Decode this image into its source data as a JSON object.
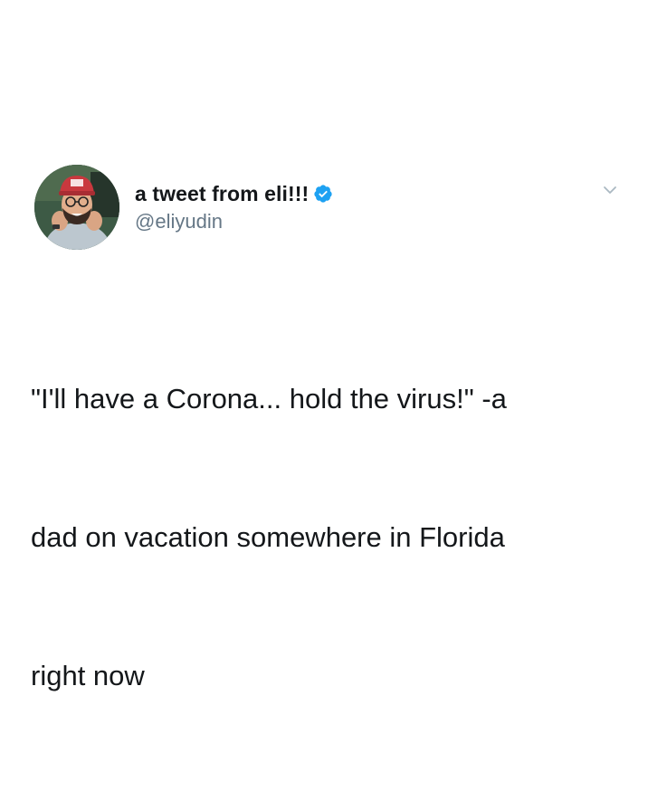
{
  "tweet": {
    "display_name": "a tweet from eli!!!",
    "handle": "@eliyudin",
    "text_lines": [
      "\"I'll have a Corona... hold the virus!\" -a",
      "dad on vacation somewhere in Florida",
      "right now"
    ]
  },
  "icons": {
    "avatar": "profile-photo",
    "verified": "verified-badge-icon",
    "chevron": "chevron-down-icon"
  },
  "colors": {
    "verified_blue": "#1da1f2",
    "handle_gray": "#657786",
    "text": "#14171a",
    "chevron_gray": "#aab8c2"
  }
}
